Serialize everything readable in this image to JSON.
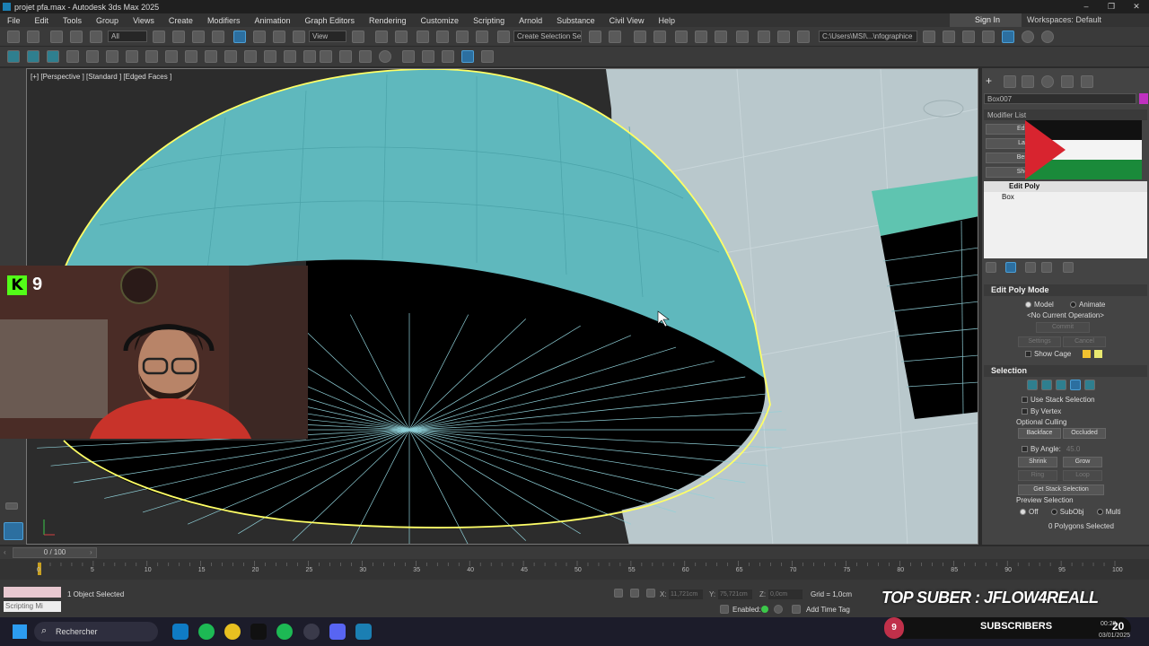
{
  "window": {
    "title": "projet pfa.max - Autodesk 3ds Max 2025",
    "controls": [
      "–",
      "❐",
      "✕"
    ]
  },
  "menu": [
    "File",
    "Edit",
    "Tools",
    "Group",
    "Views",
    "Create",
    "Modifiers",
    "Animation",
    "Graph Editors",
    "Rendering",
    "Customize",
    "Scripting",
    "Arnold",
    "Substance",
    "Civil View",
    "Help"
  ],
  "account": {
    "signin": "Sign In",
    "workspaces": "Workspaces: Default"
  },
  "toolbar": {
    "filter": "All",
    "view": "View",
    "selection_set": "Create Selection Se",
    "path": "C:\\Users\\MSI\\...\\nfographice"
  },
  "viewport": {
    "label": "[+] [Perspective ] [Standard ] [Edged Faces ]"
  },
  "webcam": {
    "platform": "K",
    "viewers": "9"
  },
  "cmdpanel": {
    "object_name": "Box007",
    "modifier_list": "Modifier List",
    "stack_buttons": [
      "Edit",
      "Lat",
      "Ben",
      "She"
    ],
    "stack_top": "Edit Poly",
    "stack_base": "Box",
    "edit_poly_mode": {
      "title": "Edit Poly Mode",
      "model": "Model",
      "animate": "Animate",
      "operation": "<No Current Operation>",
      "commit": "Commit",
      "settings": "Settings",
      "cancel": "Cancel",
      "show_cage": "Show Cage"
    },
    "selection": {
      "title": "Selection",
      "use_stack": "Use Stack Selection",
      "by_vertex": "By Vertex",
      "optional_culling": "Optional Culling",
      "backface": "Backface",
      "occluded": "Occluded",
      "by_angle": "By Angle:",
      "angle_value": "45.0",
      "shrink": "Shrink",
      "grow": "Grow",
      "ring": "Ring",
      "loop": "Loop",
      "get_stack": "Get Stack Selection",
      "preview": "Preview Selection",
      "off": "Off",
      "subobj": "SubObj",
      "multi": "Multi",
      "status": "0 Polygons Selected"
    }
  },
  "timeline": {
    "frame": "0 / 100",
    "ticks": [
      "0",
      "5",
      "10",
      "15",
      "20",
      "25",
      "30",
      "35",
      "40",
      "45",
      "50",
      "55",
      "60",
      "65",
      "70",
      "75",
      "80",
      "85",
      "90",
      "95",
      "100"
    ]
  },
  "status": {
    "selected": "1 Object Selected",
    "script": "Scripting Mi",
    "x_label": "X:",
    "x": "11,721cm",
    "y_label": "Y:",
    "y": "75,721cm",
    "z_label": "Z:",
    "z": "0,0cm",
    "grid": "Grid = 1,0cm",
    "enabled": "Enabled:",
    "add_time_tag": "Add Time Tag"
  },
  "overlay": {
    "top_suber": "TOP SUBER : JFLOW4REALL",
    "subscribers_count": "9",
    "subscribers_label": "SUBSCRIBERS",
    "subs_num": "20"
  },
  "taskbar": {
    "search": "Rechercher",
    "time": "00:20",
    "date": "03/01/2025"
  },
  "colors": {
    "accent": "#4b9fd6",
    "dome": "#5fb8bd",
    "selection": "#ffff66"
  }
}
